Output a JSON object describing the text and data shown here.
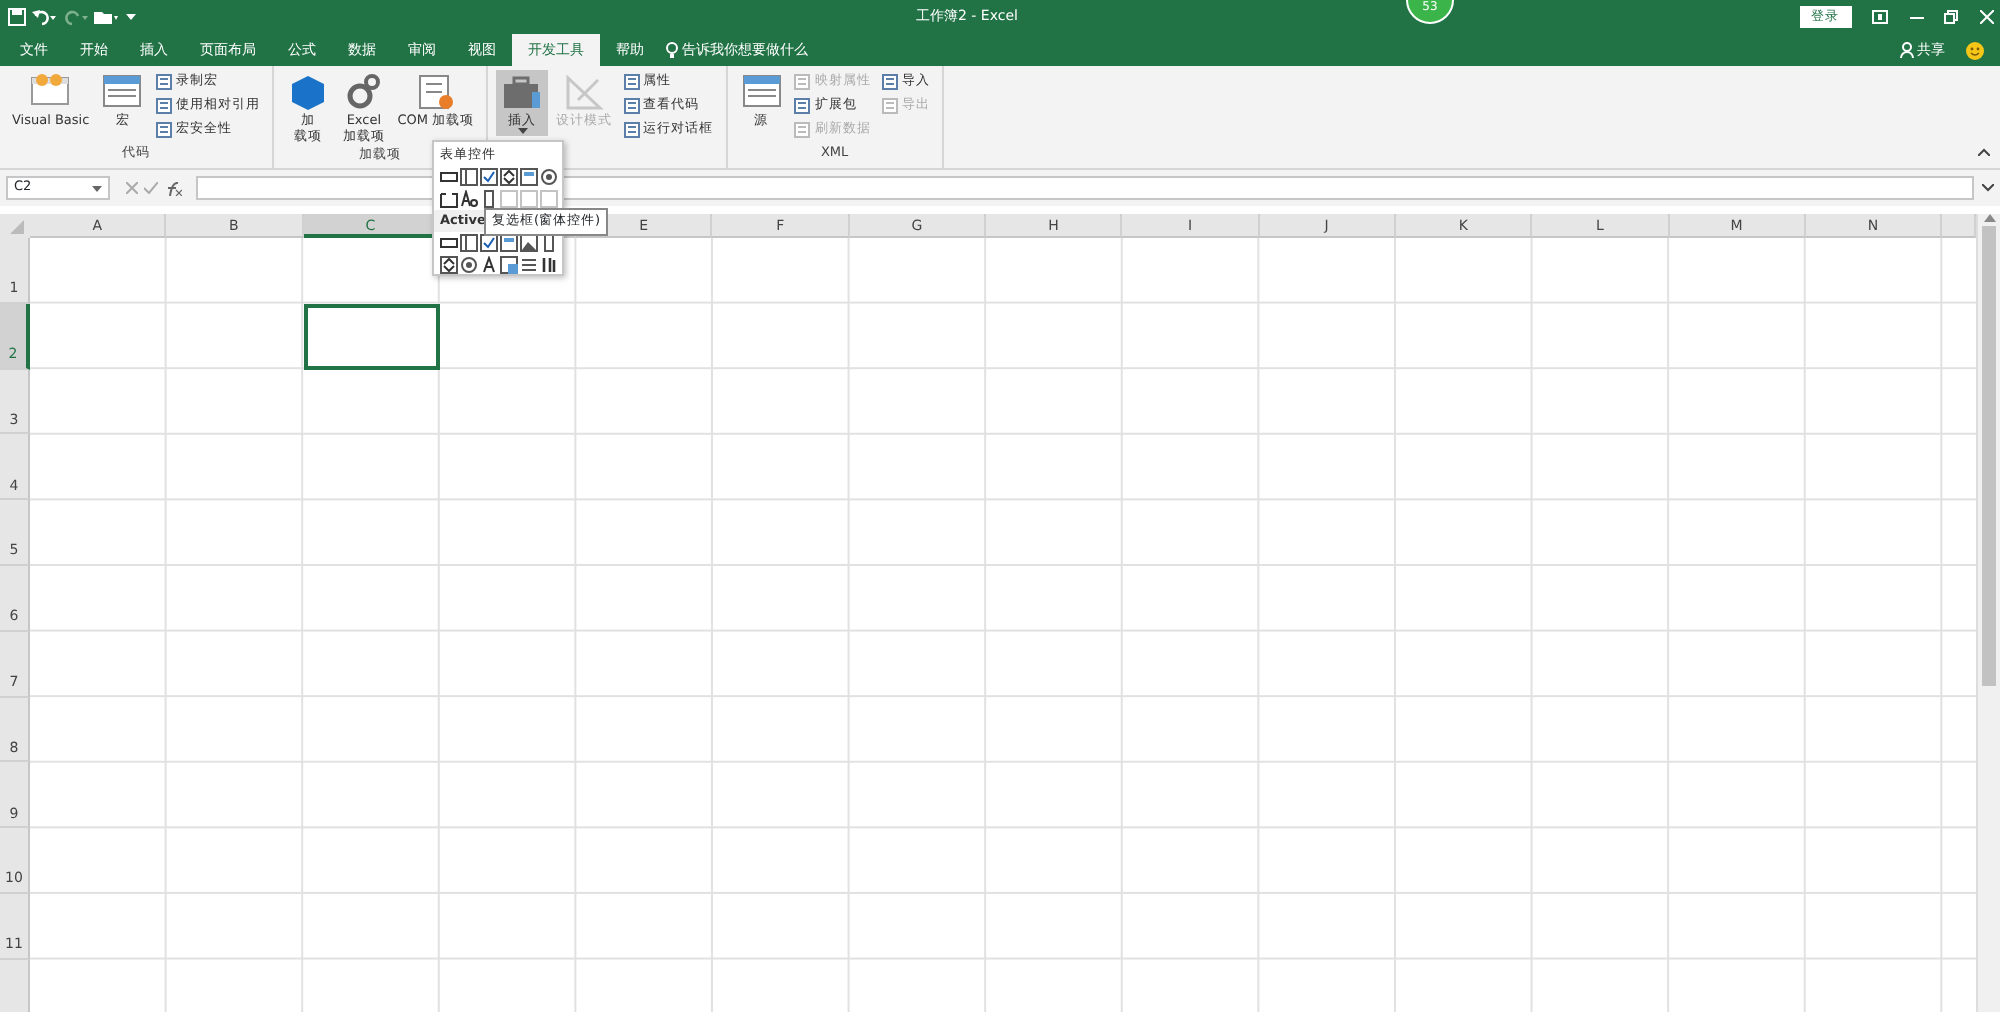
{
  "window": {
    "title": "工作簿2 - Excel",
    "login": "登录",
    "badge": "53"
  },
  "tabs": [
    {
      "label": "文件",
      "selected": false
    },
    {
      "label": "开始",
      "selected": false
    },
    {
      "label": "插入",
      "selected": false
    },
    {
      "label": "页面布局",
      "selected": false
    },
    {
      "label": "公式",
      "selected": false
    },
    {
      "label": "数据",
      "selected": false
    },
    {
      "label": "审阅",
      "selected": false
    },
    {
      "label": "视图",
      "selected": false
    },
    {
      "label": "开发工具",
      "selected": true
    },
    {
      "label": "帮助",
      "selected": false
    }
  ],
  "tell_me": "告诉我你想要做什么",
  "share": "共享",
  "ribbon_groups": [
    {
      "label": "代码",
      "large": [
        {
          "lines": [
            "Visual Basic"
          ],
          "disabled": false,
          "selected": false,
          "kind": "vb"
        },
        {
          "lines": [
            "宏"
          ],
          "disabled": false,
          "selected": false,
          "kind": "sheet"
        }
      ],
      "small": [
        {
          "label": "录制宏",
          "disabled": false
        },
        {
          "label": "使用相对引用",
          "disabled": false
        },
        {
          "label": "宏安全性",
          "disabled": false
        }
      ]
    },
    {
      "label": "加载项",
      "large": [
        {
          "lines": [
            "加",
            "载项"
          ],
          "disabled": false,
          "selected": false,
          "kind": "cube"
        },
        {
          "lines": [
            "Excel",
            "加载项"
          ],
          "disabled": false,
          "selected": false,
          "kind": "gear"
        },
        {
          "lines": [
            "COM 加载项"
          ],
          "disabled": false,
          "selected": false,
          "kind": "list"
        }
      ]
    },
    {
      "large": [
        {
          "lines": [
            "插入"
          ],
          "disabled": false,
          "selected": true,
          "kind": "toolbox"
        },
        {
          "lines": [
            "设计模式"
          ],
          "disabled": true,
          "selected": false,
          "kind": "ruler"
        }
      ],
      "small": [
        {
          "label": "属性",
          "disabled": false
        },
        {
          "label": "查看代码",
          "disabled": false
        },
        {
          "label": "运行对话框",
          "disabled": false
        }
      ]
    },
    {
      "label": "XML",
      "large": [
        {
          "lines": [
            "源"
          ],
          "disabled": false,
          "selected": false,
          "kind": "sheet"
        }
      ],
      "small": [
        {
          "label": "映射属性",
          "disabled": true
        },
        {
          "label": "扩展包",
          "disabled": false
        },
        {
          "label": "刷新数据",
          "disabled": true
        },
        {
          "label": "导入",
          "disabled": false
        },
        {
          "label": "导出",
          "disabled": true
        }
      ]
    }
  ],
  "name_box": "C2",
  "columns": [
    {
      "label": "A",
      "selected": false
    },
    {
      "label": "B",
      "selected": false
    },
    {
      "label": "C",
      "selected": true
    },
    {
      "selected": false
    },
    {
      "label": "E",
      "selected": false
    },
    {
      "label": "F",
      "selected": false
    },
    {
      "label": "G",
      "selected": false
    },
    {
      "label": "H",
      "selected": false
    },
    {
      "label": "I",
      "selected": false
    },
    {
      "label": "J",
      "selected": false
    },
    {
      "label": "K",
      "selected": false
    },
    {
      "label": "L",
      "selected": false
    },
    {
      "label": "M",
      "selected": false
    },
    {
      "label": "N",
      "selected": false
    }
  ],
  "rows": [
    {
      "label": "1",
      "selected": false
    },
    {
      "label": "2",
      "selected": true
    },
    {
      "label": "3",
      "selected": false
    },
    {
      "label": "4",
      "selected": false
    },
    {
      "label": "5",
      "selected": false
    },
    {
      "label": "6",
      "selected": false
    },
    {
      "label": "7",
      "selected": false
    },
    {
      "label": "8",
      "selected": false
    },
    {
      "label": "9",
      "selected": false
    },
    {
      "label": "10",
      "selected": false
    },
    {
      "label": "11",
      "selected": false
    }
  ],
  "insert_menu": {
    "form_header": "表单控件",
    "activex_header": "Active",
    "tooltip": "复选框(窗体控件)"
  }
}
